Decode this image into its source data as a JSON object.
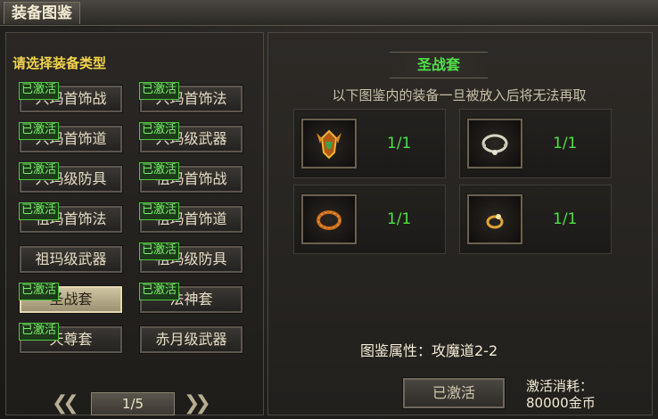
{
  "window": {
    "title": "装备图鉴"
  },
  "left": {
    "prompt": "请选择装备类型",
    "buttons": [
      {
        "label": "兴玛首饰战",
        "badge": "已激活",
        "selected": false
      },
      {
        "label": "兴玛首饰法",
        "badge": "已激活",
        "selected": false
      },
      {
        "label": "兴玛首饰道",
        "badge": "已激活",
        "selected": false
      },
      {
        "label": "兴玛级武器",
        "badge": "已激活",
        "selected": false
      },
      {
        "label": "兴玛级防具",
        "badge": "已激活",
        "selected": false
      },
      {
        "label": "祖玛首饰战",
        "badge": "已激活",
        "selected": false
      },
      {
        "label": "祖玛首饰法",
        "badge": "已激活",
        "selected": false
      },
      {
        "label": "祖玛首饰道",
        "badge": "已激活",
        "selected": false
      },
      {
        "label": "祖玛级武器",
        "badge": "",
        "selected": false
      },
      {
        "label": "祖玛级防具",
        "badge": "已激活",
        "selected": false
      },
      {
        "label": "圣战套",
        "badge": "已激活",
        "selected": true
      },
      {
        "label": "法神套",
        "badge": "已激活",
        "selected": false
      },
      {
        "label": "天尊套",
        "badge": "已激活",
        "selected": false
      },
      {
        "label": "赤月级武器",
        "badge": "",
        "selected": false
      }
    ],
    "pager": {
      "page": "1/5",
      "prev_icon": "double-chevron-left-icon",
      "next_icon": "double-chevron-right-icon"
    }
  },
  "right": {
    "set_name": "圣战套",
    "notice": "以下图鉴内的装备一旦被放入后将无法再取",
    "items": [
      {
        "icon": "helmet-icon",
        "count": "1/1"
      },
      {
        "icon": "necklace-icon",
        "count": "1/1"
      },
      {
        "icon": "bracelet-icon",
        "count": "1/1"
      },
      {
        "icon": "ring-icon",
        "count": "1/1"
      }
    ],
    "attribute": "图鉴属性：攻魔道2-2",
    "button": "已激活",
    "cost_label": "激活消耗：",
    "cost_value": "80000金币"
  },
  "colors": {
    "accent_green": "#50df46",
    "prompt_yellow": "#f2d34c"
  },
  "help_icon": "?"
}
